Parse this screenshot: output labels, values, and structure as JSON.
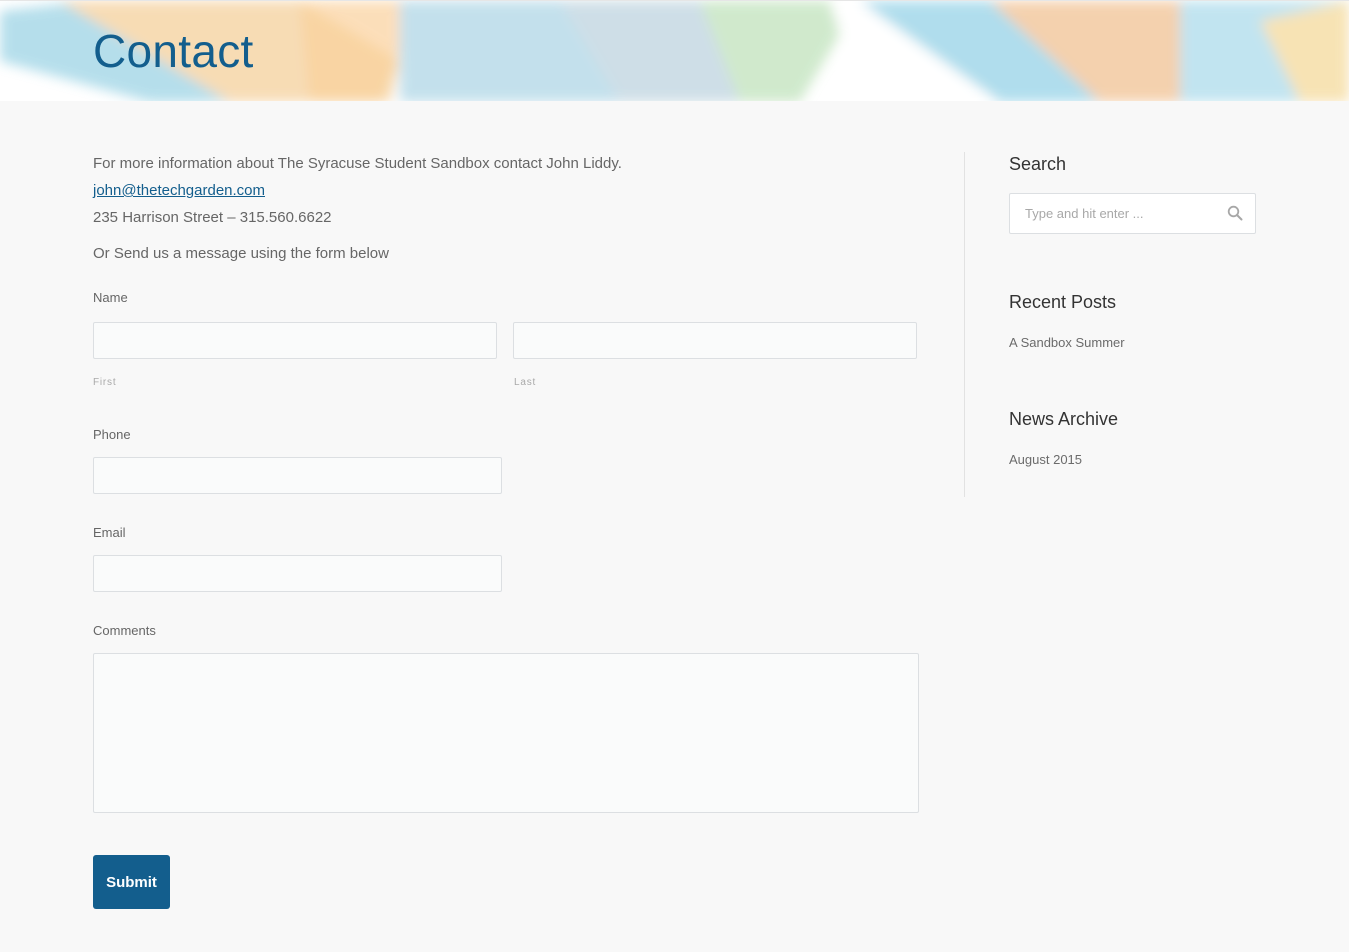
{
  "page": {
    "title": "Contact"
  },
  "intro": {
    "info_text": "For more information about The Syracuse Student Sandbox contact John Liddy.",
    "email": "john@thetechgarden.com",
    "address": "235 Harrison Street – 315.560.6622",
    "form_prompt": "Or Send us a message using the form below"
  },
  "form": {
    "name_label": "Name",
    "first_label": "First",
    "last_label": "Last",
    "first_value": "",
    "last_value": "",
    "phone_label": "Phone",
    "phone_value": "",
    "email_label": "Email",
    "email_value": "",
    "comments_label": "Comments",
    "comments_value": "",
    "submit_label": "Submit"
  },
  "sidebar": {
    "search": {
      "title": "Search",
      "placeholder": "Type and hit enter ..."
    },
    "recent_posts": {
      "title": "Recent Posts",
      "items": [
        "A Sandbox Summer"
      ]
    },
    "archive": {
      "title": "News Archive",
      "items": [
        "August 2015"
      ]
    }
  },
  "colors": {
    "accent": "#135e8d",
    "background": "#f8f8f8",
    "text": "#666666"
  },
  "icons": {
    "search": "magnifier-icon"
  }
}
